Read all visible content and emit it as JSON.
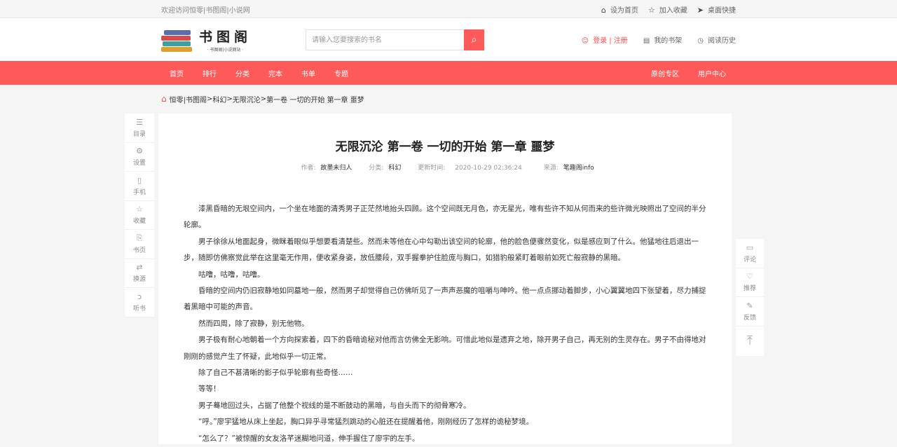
{
  "topbar": {
    "welcome": "欢迎访问恒零|书图阁|小说网",
    "set_home": "设为首页",
    "add_fav": "加入收藏",
    "desktop": "桌面快捷"
  },
  "header": {
    "logo_text": "书图阁",
    "logo_sub": "· 书图阁|小说网站 ·",
    "search_placeholder": "请输入您要搜索的书名",
    "login": "登录 | 注册",
    "my_shelf": "我的书架",
    "history": "阅读历史"
  },
  "nav": {
    "items": [
      "首页",
      "排行",
      "分类",
      "完本",
      "书单",
      "专题"
    ],
    "right": [
      "原创专区",
      "用户中心"
    ]
  },
  "breadcrumb": {
    "items": [
      "恒零|书图阁",
      "科幻",
      "无限沉沦",
      "第一卷 一切的开始 第一章 噩梦"
    ],
    "sep": " > "
  },
  "left_tools": [
    {
      "icon": "list-icon",
      "glyph": "☰",
      "label": "目录"
    },
    {
      "icon": "settings-icon",
      "glyph": "⚙",
      "label": "设置"
    },
    {
      "icon": "phone-icon",
      "glyph": "▯",
      "label": "手机"
    },
    {
      "icon": "star-icon",
      "glyph": "☆",
      "label": "收藏"
    },
    {
      "icon": "bookmark-icon",
      "glyph": "⎘",
      "label": "书页"
    },
    {
      "icon": "switch-icon",
      "glyph": "⇄",
      "label": "换源"
    },
    {
      "icon": "ear-icon",
      "glyph": "ↄ",
      "label": "听书"
    }
  ],
  "right_tools": [
    {
      "icon": "comment-icon",
      "glyph": "▭",
      "label": "评论"
    },
    {
      "icon": "thumb-icon",
      "glyph": "♡",
      "label": "推荐"
    },
    {
      "icon": "pen-icon",
      "glyph": "✎",
      "label": "反馈"
    }
  ],
  "back_top_glyph": "⤒",
  "article": {
    "title": "无限沉沦 第一卷 一切的开始 第一章 噩梦",
    "author_label": "作者:",
    "author": "故墨未归人",
    "category_label": "分类:",
    "category": "科幻",
    "updated_label": "更新时间:",
    "updated": "2020-10-29 02:36:24",
    "source_label": "来源:",
    "source": "笔趣阁info",
    "paragraphs": [
      "漆黑昏暗的无垠空间内，一个坐在地面的清秀男子正茫然地抬头四顾。这个空间既无月色，亦无星光，唯有些许不知从何而来的些许微光映照出了空间的半分轮廓。",
      "男子徐徐从地面起身，微眯着眼似乎想要看清楚些。然而未等他在心中勾勒出该空间的轮廓，他的脸色便骤然变化，似是感应到了什么。他猛地往后退出一步，随即仿佛察觉此举在这里毫无作用，便收紧身姿，放低腰段，双手握拳护住脸庞与胸口，如猎豹般紧盯着眼前如死亡般寂静的黑暗。",
      "咕噜，咕噜，咕噜。",
      "昏暗的空间内仍旧寂静地如同墓地一般，然而男子却觉得自己仿佛听见了一声声恶魔的咀嚼与呻吟。他一点点挪动着脚步，小心翼翼地四下张望着，尽力捕捉着黑暗中可能的声音。",
      "然而四周，除了寂静，别无他物。",
      "男子极有耐心地朝着一个方向探索着，四下的昏暗诡秘对他而言仿佛全无影响。可惜此地似是遗弃之地，除开男子自己，再无别的生灵存在。男子不由得地对刚刚的感觉产生了怀疑，此地似乎一切正常。",
      "除了自己不甚清晰的影子似乎轮廓有些奇怪……",
      "等等！",
      "男子蓦地回过头，占据了他整个视线的是不断鼓动的黑暗，与自头而下的彻骨寒冷。",
      "“呼。”廖宇猛地从床上坐起，胸口异乎寻常猛烈跳动的心脏还在提醒着他，刚刚经历了怎样的诡秘梦境。",
      "“怎么了？”被惊醒的女友洛芊迷糊地问道，伸手握住了廖宇的左手。"
    ]
  }
}
